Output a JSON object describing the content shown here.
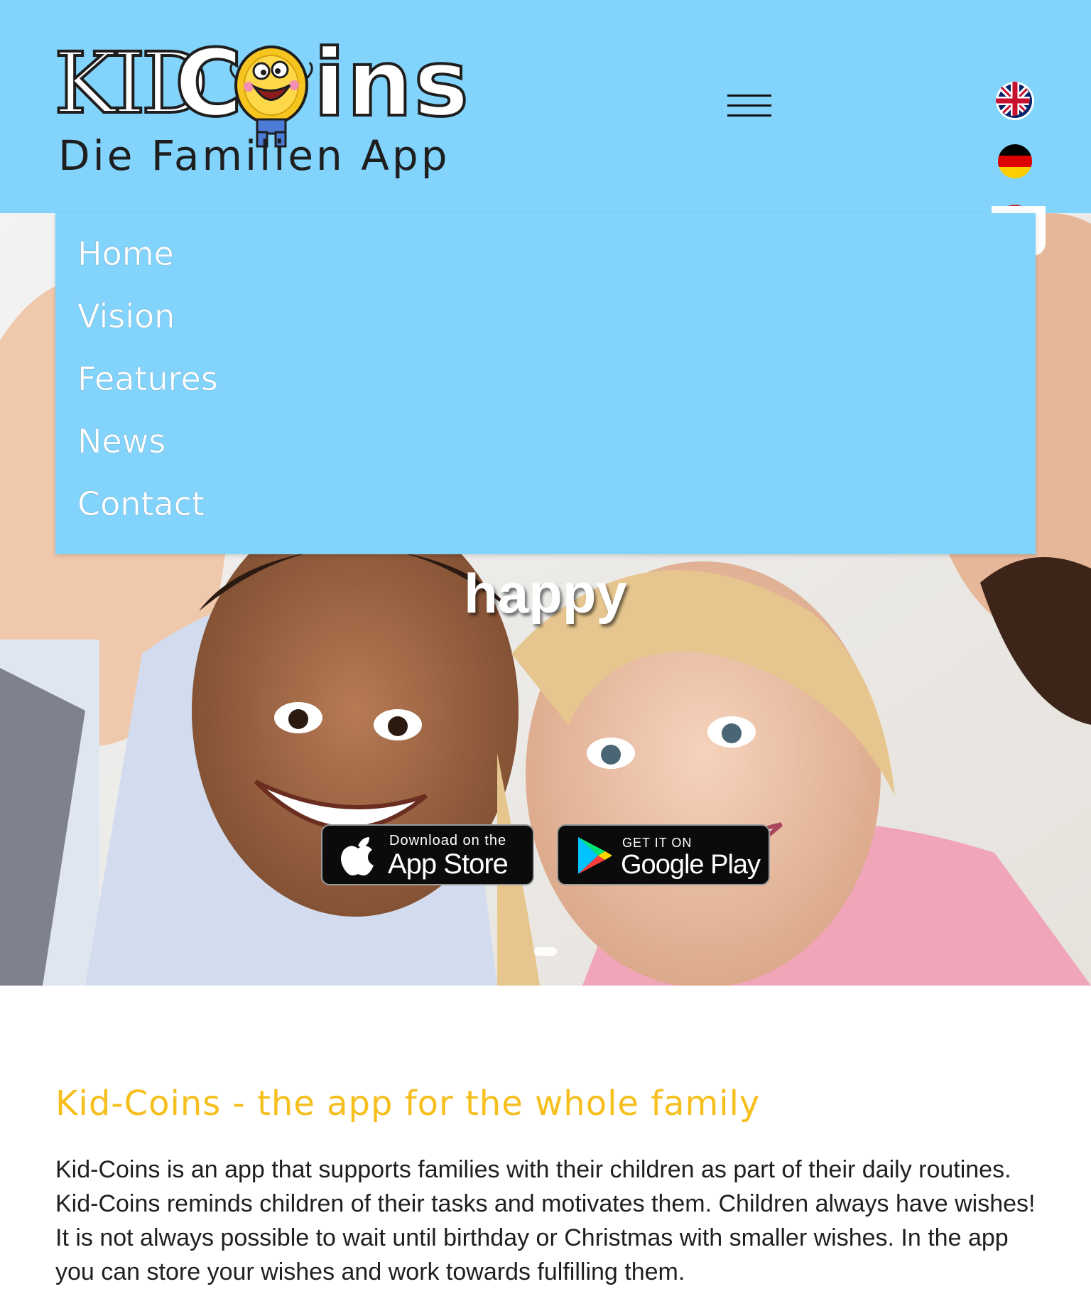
{
  "brand": {
    "logo_part1": "KID",
    "logo_part2_before": "C",
    "logo_part2_after": "ins",
    "tagline": "Die Familien App",
    "accent_color": "#82d4fc",
    "title_color": "#f6bf1d"
  },
  "header": {
    "menu_icon": "hamburger-icon",
    "languages": [
      {
        "name": "english",
        "icon": "uk-flag-icon"
      },
      {
        "name": "german",
        "icon": "germany-flag-icon"
      },
      {
        "name": "other",
        "icon": "red-flag-icon"
      }
    ]
  },
  "nav": {
    "items": [
      {
        "label": "Home"
      },
      {
        "label": "Vision"
      },
      {
        "label": "Features"
      },
      {
        "label": "News"
      },
      {
        "label": "Contact"
      }
    ]
  },
  "hero": {
    "word": "happy",
    "app_store": {
      "small": "Download on the",
      "big": "App Store",
      "icon": "apple-icon"
    },
    "google_play": {
      "small": "GET IT ON",
      "big": "Google Play",
      "icon": "google-play-icon"
    }
  },
  "content": {
    "title": "Kid-Coins - the app for the whole family",
    "body": "Kid-Coins is an app that supports families with their children as part of their daily routines. Kid-Coins reminds children of their tasks and motivates them. Children always have wishes! It is not always possible to wait until birthday or Christmas with smaller wishes. In the app you can store your wishes and work towards fulfilling them."
  }
}
